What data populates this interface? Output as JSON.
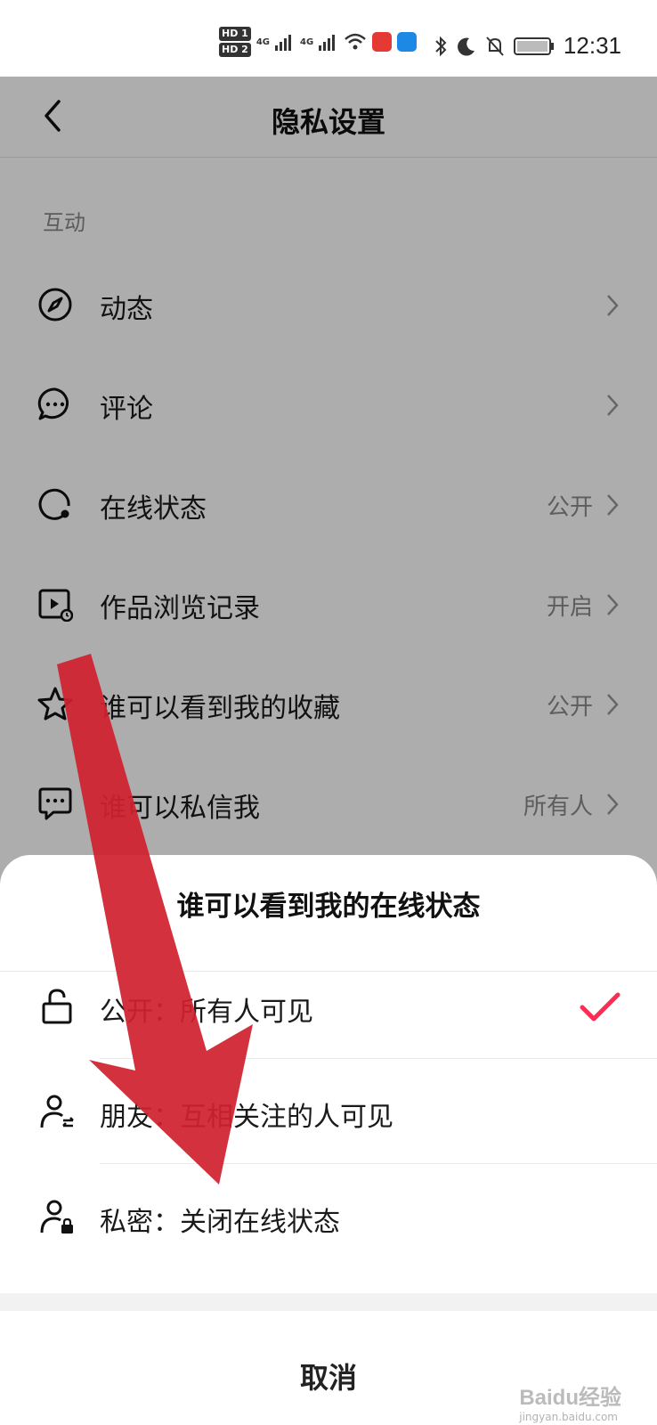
{
  "status_bar": {
    "time": "12:31",
    "sim1": "HD 1",
    "sim2": "HD 2",
    "net1": "4G",
    "net2": "4G"
  },
  "nav": {
    "title": "隐私设置"
  },
  "section": {
    "label": "互动"
  },
  "rows": [
    {
      "label": "动态",
      "value": ""
    },
    {
      "label": "评论",
      "value": ""
    },
    {
      "label": "在线状态",
      "value": "公开"
    },
    {
      "label": "作品浏览记录",
      "value": "开启"
    },
    {
      "label": "谁可以看到我的收藏",
      "value": "公开"
    },
    {
      "label": "谁可以私信我",
      "value": "所有人"
    }
  ],
  "sheet": {
    "title": "谁可以看到我的在线状态",
    "options": [
      {
        "label": "公开：所有人可见",
        "selected": true
      },
      {
        "label": "朋友：互相关注的人可见",
        "selected": false
      },
      {
        "label": "私密：关闭在线状态",
        "selected": false
      }
    ],
    "cancel": "取消"
  },
  "watermark": {
    "brand": "Baidu经验",
    "site": "jingyan.baidu.com"
  },
  "colors": {
    "accent_check": "#fe2c55",
    "arrow": "#d0212e",
    "overlay": "rgba(0,0,0,0.32)"
  }
}
